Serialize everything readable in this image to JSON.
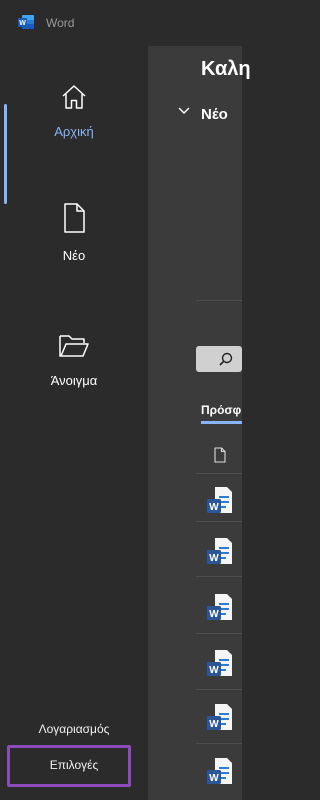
{
  "window": {
    "title": "Word"
  },
  "nav": {
    "home_label": "Αρχική",
    "new_label": "Νέο",
    "open_label": "Άνοιγμα",
    "account_label": "Λογαριασμός",
    "options_label": "Επιλογές"
  },
  "main": {
    "greeting": "Καλη",
    "new_section": "Νέο",
    "recent_tab": "Πρόσφ"
  },
  "colors": {
    "accent": "#8ab4f8",
    "highlight": "#8b4bb8",
    "nav_bg": "#2b2b2b",
    "content_bg": "#3b3b3b",
    "word_blue": "#2b579a"
  }
}
